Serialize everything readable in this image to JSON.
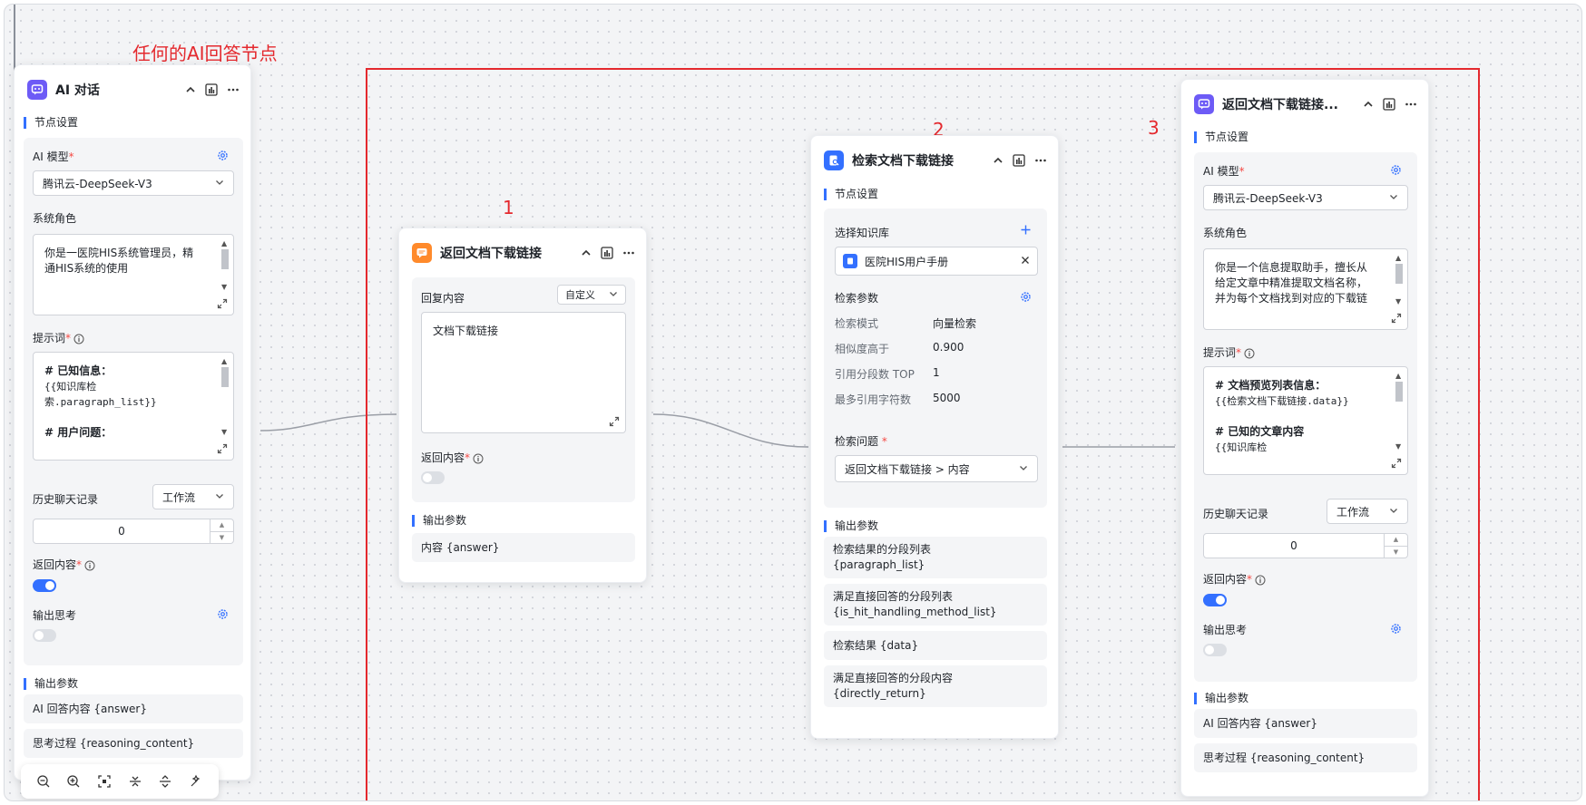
{
  "annotations": {
    "left_title": "任何的AI回答节点",
    "num1": "1",
    "num2": "2",
    "num3": "3"
  },
  "colors": {
    "accent": "#3370ff",
    "annotation_red": "#e4292e"
  },
  "node_ai_chat": {
    "title": "AI 对话",
    "section_settings": "节点设置",
    "model_label": "AI 模型",
    "model_value": "腾讯云-DeepSeek-V3",
    "role_label": "系统角色",
    "role_lines": [
      "你是一医院HIS系统管理员，精",
      "通HIS系统的使用"
    ],
    "prompt_label": "提示词",
    "prompt_lines": [
      "# 已知信息：",
      "{{知识库检",
      "索.paragraph_list}}",
      "",
      "# 用户问题："
    ],
    "history_label": "历史聊天记录",
    "history_select": "工作流",
    "history_count": "0",
    "return_label": "返回内容",
    "return_on": true,
    "think_label": "输出思考",
    "think_on": false,
    "section_output": "输出参数",
    "outputs": [
      "AI 回答内容 {answer}",
      "思考过程 {reasoning_content}"
    ]
  },
  "node_reply": {
    "title": "返回文档下载链接",
    "reply_label": "回复内容",
    "reply_mode": "自定义",
    "reply_text": "文档下载链接",
    "return_label": "返回内容",
    "return_on": false,
    "section_output": "输出参数",
    "outputs": [
      "内容 {answer}"
    ]
  },
  "node_search": {
    "title": "检索文档下载链接",
    "section_settings": "节点设置",
    "kb_label": "选择知识库",
    "kb_name": "医院HIS用户手册",
    "params_label": "检索参数",
    "params": [
      {
        "k": "检索模式",
        "v": "向量检索"
      },
      {
        "k": "相似度高于",
        "v": "0.900"
      },
      {
        "k": "引用分段数 TOP",
        "v": "1"
      },
      {
        "k": "最多引用字符数",
        "v": "5000"
      }
    ],
    "question_label": "检索问题",
    "question_value": "返回文档下载链接 > 内容",
    "section_output": "输出参数",
    "outputs": [
      [
        "检索结果的分段列表",
        "{paragraph_list}"
      ],
      [
        "满足直接回答的分段列表",
        "{is_hit_handling_method_list}"
      ],
      [
        "检索结果 {data}"
      ],
      [
        "满足直接回答的分段内容",
        "{directly_return}"
      ]
    ]
  },
  "node_ai_return": {
    "title": "返回文档下载链接...",
    "section_settings": "节点设置",
    "model_label": "AI 模型",
    "model_value": "腾讯云-DeepSeek-V3",
    "role_label": "系统角色",
    "role_lines": [
      "你是一个信息提取助手，擅长从",
      "给定文章中精准提取文档名称，",
      "并为每个文档找到对应的下载链"
    ],
    "prompt_label": "提示词",
    "prompt_lines": [
      "# 文档预览列表信息：",
      "{{检索文档下载链接.data}}",
      "",
      "# 已知的文章内容",
      "{{知识库检"
    ],
    "history_label": "历史聊天记录",
    "history_select": "工作流",
    "history_count": "0",
    "return_label": "返回内容",
    "return_on": true,
    "think_label": "输出思考",
    "think_on": false,
    "section_output": "输出参数",
    "outputs": [
      "AI 回答内容 {answer}",
      "思考过程 {reasoning_content}"
    ]
  },
  "toolbar": [
    "zoom-out-icon",
    "zoom-in-icon",
    "fit-view-icon",
    "collapse-icon",
    "expand-icon",
    "beautify-icon"
  ]
}
